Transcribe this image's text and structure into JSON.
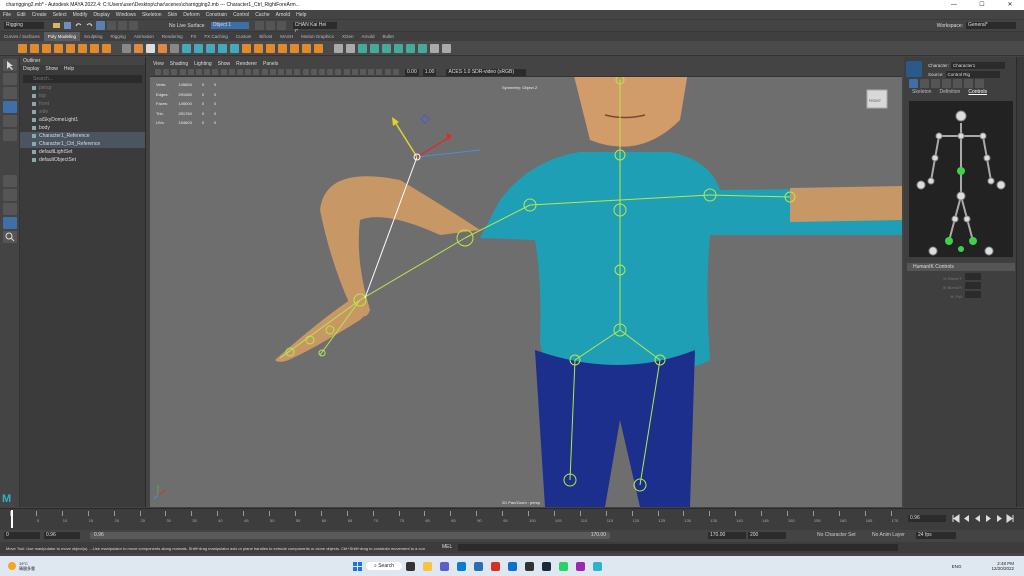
{
  "window": {
    "title": "charrigging2.mb* - Autodesk MAYA 2022.4: C:\\Users\\user\\Desktop\\char\\scenes\\charrigging2.mb --- Character1_Ctrl_RightForeArm...",
    "min": "—",
    "max": "☐",
    "close": "✕"
  },
  "menu": [
    "File",
    "Edit",
    "Create",
    "Select",
    "Modify",
    "Display",
    "Windows",
    "Skeleton",
    "Skin",
    "Deform",
    "Constrain",
    "Control",
    "Cache",
    "Arnold",
    "Help"
  ],
  "status": {
    "mode": "Rigging",
    "live_surface": "No Live Surface",
    "workspace_label": "Workspace:",
    "workspace_value": "General*",
    "object_field": "Object 1",
    "user": "CHAN Kai Hei C..."
  },
  "shelf_tabs": [
    "Curves / Surfaces",
    "Poly Modeling",
    "Sculpting",
    "Rigging",
    "Animation",
    "Rendering",
    "FX",
    "FX Caching",
    "Custom",
    "Bifrost",
    "MASH",
    "Motion Graphics",
    "XGen",
    "Arnold",
    "Bullet"
  ],
  "shelf_active": "Poly Modeling",
  "outliner": {
    "title": "Outliner",
    "menus": [
      "Display",
      "Show",
      "Help"
    ],
    "search": "Search...",
    "items": [
      {
        "label": "persp",
        "dim": true
      },
      {
        "label": "top",
        "dim": true
      },
      {
        "label": "front",
        "dim": true
      },
      {
        "label": "side",
        "dim": true
      },
      {
        "label": "aiSkyDomeLight1",
        "dim": false
      },
      {
        "label": "body",
        "dim": false
      },
      {
        "label": "Character1_Reference",
        "dim": false,
        "sel": true
      },
      {
        "label": "Character1_Ctrl_Reference",
        "dim": false,
        "sel": true
      },
      {
        "label": "defaultLightSet",
        "dim": false
      },
      {
        "label": "defaultObjectSet",
        "dim": false
      }
    ]
  },
  "viewport": {
    "menus": [
      "View",
      "Shading",
      "Lighting",
      "Show",
      "Renderer",
      "Panels"
    ],
    "stats": [
      [
        "Verts:",
        "145654",
        "0",
        "0"
      ],
      [
        "Edges:",
        "291080",
        "0",
        "0"
      ],
      [
        "Faces:",
        "145000",
        "0",
        "0"
      ],
      [
        "Tris:",
        "291760",
        "0",
        "0"
      ],
      [
        "UVs:",
        "154603",
        "0",
        "0"
      ]
    ],
    "symmetry": "Symmetry: Object Z",
    "camera": "2D Pan/Zoom : persp",
    "cube": "FRONT",
    "exposure": "0.00",
    "gamma": "1.00",
    "colorspace": "ACES 1.0 SDR-video (sRGB)"
  },
  "right_panel": {
    "character_label": "Character:",
    "character_value": "Character1",
    "source_label": "Source:",
    "source_value": "Control Rig",
    "tabs": [
      "Skeleton",
      "Definition",
      "Controls"
    ],
    "active_tab": "Controls",
    "hik_header": "HumanIK Controls",
    "hik_rows": [
      "IK Blend T",
      "IK Blend R",
      "IK Pull"
    ]
  },
  "timeline": {
    "current": "0.96",
    "start": "0",
    "range_start": "0.96",
    "range_mid": "0.96",
    "range_end": "170.00",
    "anim_end": "170.00",
    "total": "200",
    "fps": "24 fps",
    "char_set": "No Character Set",
    "anim_layer": "No Anim Layer",
    "ticks": [
      "0",
      "5",
      "10",
      "15",
      "20",
      "25",
      "30",
      "35",
      "40",
      "45",
      "50",
      "55",
      "60",
      "65",
      "70",
      "75",
      "80",
      "85",
      "90",
      "95",
      "100",
      "105",
      "110",
      "115",
      "120",
      "125",
      "130",
      "135",
      "140",
      "145",
      "150",
      "155",
      "160",
      "165",
      "170"
    ]
  },
  "cmd": {
    "mel": "MEL",
    "help": "Move Tool: Use manipulator to move object(s). ...Use manipulator to move components along normals. Shift+drag manipulator axis or plane handles to extrude components or clone objects. Ctrl+Shift+drag to constrain movement to a con"
  },
  "taskbar": {
    "weather_temp": "19°C",
    "weather_desc": "晴間多雲",
    "search": "Search",
    "lang": "ENG",
    "time": "2:48 PM",
    "date": "12/20/2022"
  },
  "colors": {
    "shirt": "#1f9fb5",
    "pants": "#1c2f8c",
    "skin": "#c79865",
    "joint": "#b7e84a",
    "accent": "#4a8fd8"
  }
}
